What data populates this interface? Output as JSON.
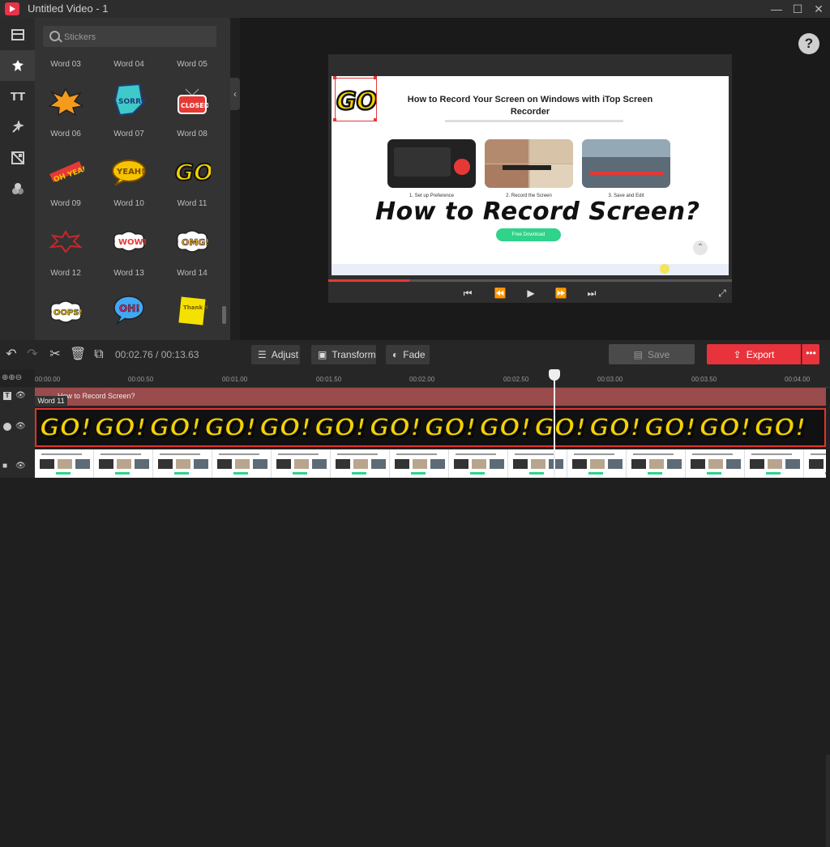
{
  "window": {
    "title": "Untitled Video - 1"
  },
  "search": {
    "placeholder": "Stickers"
  },
  "stickers": {
    "top_labels": [
      "Word 03",
      "Word 04",
      "Word 05"
    ],
    "rows": [
      {
        "labels": [
          "Word 06",
          "Word 07",
          "Word 08"
        ],
        "stickers": [
          {
            "text": "",
            "color": "#f49b1c"
          },
          {
            "text": "SORRY",
            "color": "#3fc9c9"
          },
          {
            "text": "CLOSED",
            "color": "#e53935"
          }
        ]
      },
      {
        "labels": [
          "Word 09",
          "Word 10",
          "Word 11"
        ],
        "stickers": [
          {
            "text": "OH YEAH",
            "color": "#f5c400"
          },
          {
            "text": "YEAH!",
            "color": "#f5c400"
          },
          {
            "text": "GO!",
            "color": "#f5d200"
          }
        ]
      },
      {
        "labels": [
          "Word 12",
          "Word 13",
          "Word 14"
        ],
        "stickers": [
          {
            "text": "",
            "color": "#c62828"
          },
          {
            "text": "WOW!",
            "color": "#e53935"
          },
          {
            "text": "OMG!",
            "color": "#f5a623"
          }
        ]
      },
      {
        "labels": [
          "",
          "",
          ""
        ],
        "stickers": [
          {
            "text": "OOPS!",
            "color": "#f5c400"
          },
          {
            "text": "OH!",
            "color": "#e91e63"
          },
          {
            "text": "Thank You!",
            "color": "#f5e100"
          }
        ]
      }
    ]
  },
  "preview": {
    "page_title": "How to Record Your Screen on Windows with iTop Screen Recorder",
    "steps": [
      "1. Set up Preference",
      "2. Record the Screen",
      "3. Save and Edit"
    ],
    "overlay_text": "How to Record Screen?",
    "free_download": "Free Download",
    "sticker_text": "GO!",
    "progress": 0.2
  },
  "toolbar": {
    "timecode": "00:02.76 / 00:13.63",
    "adjust": "Adjust",
    "transform": "Transform",
    "fade": "Fade",
    "save": "Save",
    "export": "Export",
    "more": "•••"
  },
  "timeline": {
    "ticks": [
      "00:00.00",
      "00:00.50",
      "00:01.00",
      "00:01.50",
      "00:02.00",
      "00:02.50",
      "00:03.00",
      "00:03.50",
      "00:04.00"
    ],
    "text_clip": "How to Record Screen?",
    "word_tag": "Word 11",
    "sticker_tile": "GO!"
  },
  "colors": {
    "accent": "#e8333c",
    "sticker_yellow": "#f5d200"
  }
}
